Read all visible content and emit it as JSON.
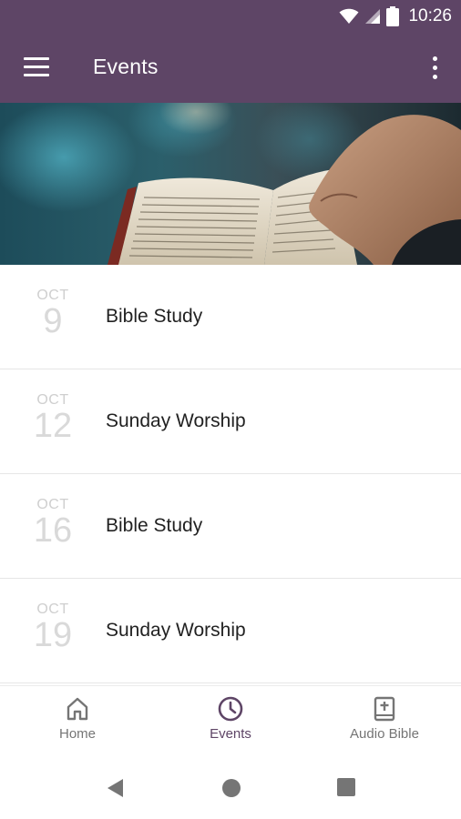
{
  "status_bar": {
    "time": "10:26",
    "icons": [
      "wifi-icon",
      "signal-icon",
      "battery-icon"
    ]
  },
  "app_bar": {
    "title": "Events",
    "color": "#5e4566",
    "icons": [
      "menu-icon",
      "more-vert-icon"
    ]
  },
  "hero": {
    "icon": "bible-hands-photo"
  },
  "events": [
    {
      "month": "OCT",
      "day": "9",
      "title": "Bible Study"
    },
    {
      "month": "OCT",
      "day": "12",
      "title": "Sunday Worship"
    },
    {
      "month": "OCT",
      "day": "16",
      "title": "Bible Study"
    },
    {
      "month": "OCT",
      "day": "19",
      "title": "Sunday Worship"
    }
  ],
  "bottom_nav": {
    "items": [
      {
        "label": "Home",
        "icon": "home-icon",
        "active": false
      },
      {
        "label": "Events",
        "icon": "clock-icon",
        "active": true
      },
      {
        "label": "Audio Bible",
        "icon": "bible-icon",
        "active": false
      }
    ],
    "active_color": "#5e4566"
  },
  "system_nav": {
    "icons": [
      "back-icon",
      "home-circle-icon",
      "recents-icon"
    ]
  }
}
